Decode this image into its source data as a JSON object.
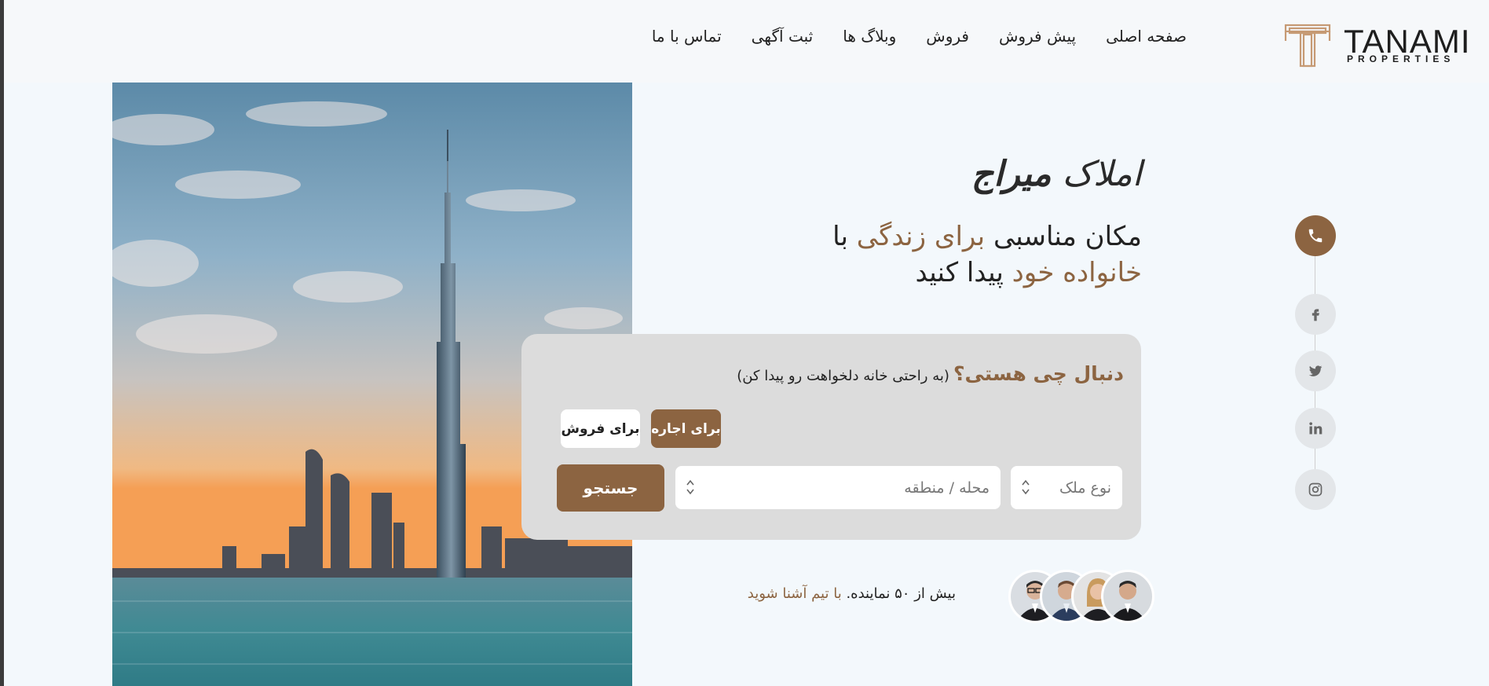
{
  "brand": {
    "name": "TANAMI",
    "sub": "PROPERTIES"
  },
  "nav": [
    {
      "label": "صفحه اصلی"
    },
    {
      "label": "پیش فروش"
    },
    {
      "label": "فروش"
    },
    {
      "label": "وبلاگ ها"
    },
    {
      "label": "ثبت آگهی"
    },
    {
      "label": "تماس با ما"
    }
  ],
  "hero": {
    "title_light": "املاک",
    "title_bold": "میراج",
    "subtitle_1": "مکان مناسبی",
    "subtitle_accent_1": "برای زندگی",
    "subtitle_2": "با",
    "subtitle_accent_2": "خانواده خود",
    "subtitle_3": "پیدا کنید"
  },
  "search": {
    "question": "دنبال چی هستی؟",
    "hint": "(به راحتی خانه دلخواهت رو پیدا کن)",
    "tab_rent": "برای اجاره",
    "tab_sale": "برای فروش",
    "type_placeholder": "نوع ملک",
    "area_placeholder": "محله / منطقه",
    "button": "جستجو"
  },
  "agents": {
    "text": "بیش از ۵۰ نماینده.",
    "link": "با تیم آشنا شوید"
  },
  "colors": {
    "accent": "#8c6441",
    "card": "#dcdcdc",
    "background": "#f3f8fc"
  },
  "social": [
    "phone-icon",
    "facebook-icon",
    "twitter-icon",
    "linkedin-icon",
    "instagram-icon"
  ]
}
